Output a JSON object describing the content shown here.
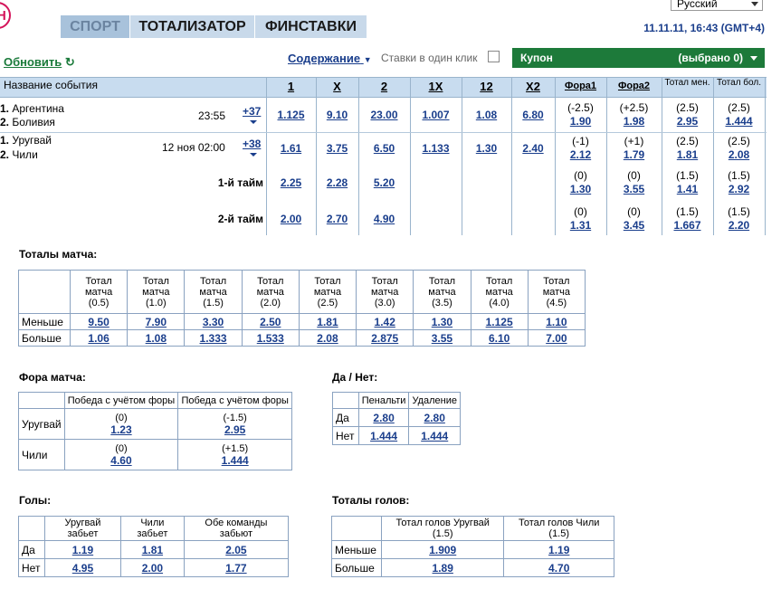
{
  "header": {
    "logo_letter": "Н",
    "tabs": [
      {
        "label": "СПОРТ",
        "active": true
      },
      {
        "label": "ТОТАЛИЗАТОР",
        "active": false
      },
      {
        "label": "ФИНСТАВКИ",
        "active": false
      }
    ],
    "language": "Русский",
    "datetime": "11.11.11, 16:43 (GMT+4)"
  },
  "toolbar": {
    "refresh_label": "Обновить",
    "contents_label": "Содержание",
    "one_click_label": "Ставки в один клик",
    "coupon_label": "Купон",
    "coupon_count": "(выбрано 0)"
  },
  "grid": {
    "columns": {
      "event": "Название события",
      "c1": "1",
      "cx": "X",
      "c2": "2",
      "c1x": "1X",
      "c12": "12",
      "cx2": "X2",
      "fora1": "Фора1",
      "fora2": "Фора2",
      "total_less": "Тотал мен.",
      "total_more": "Тотал бол."
    },
    "events": [
      {
        "team1": "Аргентина",
        "team2": "Боливия",
        "n1": "1.",
        "n2": "2.",
        "time": "23:55",
        "more": "+37",
        "odds": [
          "1.125",
          "9.10",
          "23.00",
          "1.007",
          "1.08",
          "6.80"
        ],
        "fora1_h": "(-2.5)",
        "fora1": "1.90",
        "fora2_h": "(+2.5)",
        "fora2": "1.98",
        "tl_h": "(2.5)",
        "tl": "2.95",
        "tm_h": "(2.5)",
        "tm": "1.444"
      },
      {
        "team1": "Уругвай",
        "team2": "Чили",
        "n1": "1.",
        "n2": "2.",
        "time": "12 ноя 02:00",
        "more": "+38",
        "odds": [
          "1.61",
          "3.75",
          "6.50",
          "1.133",
          "1.30",
          "2.40"
        ],
        "fora1_h": "(-1)",
        "fora1": "2.12",
        "fora2_h": "(+1)",
        "fora2": "1.79",
        "tl_h": "(2.5)",
        "tl": "1.81",
        "tm_h": "(2.5)",
        "tm": "2.08"
      }
    ],
    "halves": [
      {
        "label": "1-й тайм",
        "odds": [
          "2.25",
          "2.28",
          "5.20"
        ],
        "fora1_h": "(0)",
        "fora1": "1.30",
        "fora2_h": "(0)",
        "fora2": "3.55",
        "tl_h": "(1.5)",
        "tl": "1.41",
        "tm_h": "(1.5)",
        "tm": "2.92"
      },
      {
        "label": "2-й тайм",
        "odds": [
          "2.00",
          "2.70",
          "4.90"
        ],
        "fora1_h": "(0)",
        "fora1": "1.31",
        "fora2_h": "(0)",
        "fora2": "3.45",
        "tl_h": "(1.5)",
        "tl": "1.667",
        "tm_h": "(1.5)",
        "tm": "2.20"
      }
    ]
  },
  "totals_match": {
    "title": "Тоталы матча:",
    "header_word1": "Тотал",
    "header_word2": "матча",
    "lines": [
      "(0.5)",
      "(1.0)",
      "(1.5)",
      "(2.0)",
      "(2.5)",
      "(3.0)",
      "(3.5)",
      "(4.0)",
      "(4.5)"
    ],
    "less_label": "Меньше",
    "less": [
      "9.50",
      "7.90",
      "3.30",
      "2.50",
      "1.81",
      "1.42",
      "1.30",
      "1.125",
      "1.10"
    ],
    "more_label": "Больше",
    "more": [
      "1.06",
      "1.08",
      "1.333",
      "1.533",
      "2.08",
      "2.875",
      "3.55",
      "6.10",
      "7.00"
    ]
  },
  "fora_match": {
    "title": "Фора матча:",
    "col": "Победа с учётом форы",
    "rows": [
      {
        "team": "Уругвай",
        "h1": "(0)",
        "o1": "1.23",
        "h2": "(-1.5)",
        "o2": "2.95"
      },
      {
        "team": "Чили",
        "h1": "(0)",
        "o1": "4.60",
        "h2": "(+1.5)",
        "o2": "1.444"
      }
    ]
  },
  "yes_no": {
    "title": "Да / Нет:",
    "cols": [
      "Пенальти",
      "Удаление"
    ],
    "rows": [
      {
        "label": "Да",
        "v": [
          "2.80",
          "2.80"
        ]
      },
      {
        "label": "Нет",
        "v": [
          "1.444",
          "1.444"
        ]
      }
    ]
  },
  "goals": {
    "title": "Голы:",
    "cols": [
      "Уругвай забьет",
      "Чили забьет",
      "Обе команды забьют"
    ],
    "rows": [
      {
        "label": "Да",
        "v": [
          "1.19",
          "1.81",
          "2.05"
        ]
      },
      {
        "label": "Нет",
        "v": [
          "4.95",
          "2.00",
          "1.77"
        ]
      }
    ]
  },
  "total_goals": {
    "title": "Тоталы голов:",
    "cols": [
      "Тотал голов Уругвай (1.5)",
      "Тотал голов Чили (1.5)"
    ],
    "rows": [
      {
        "label": "Меньше",
        "v": [
          "1.909",
          "1.19"
        ]
      },
      {
        "label": "Больше",
        "v": [
          "1.89",
          "4.70"
        ]
      }
    ]
  }
}
